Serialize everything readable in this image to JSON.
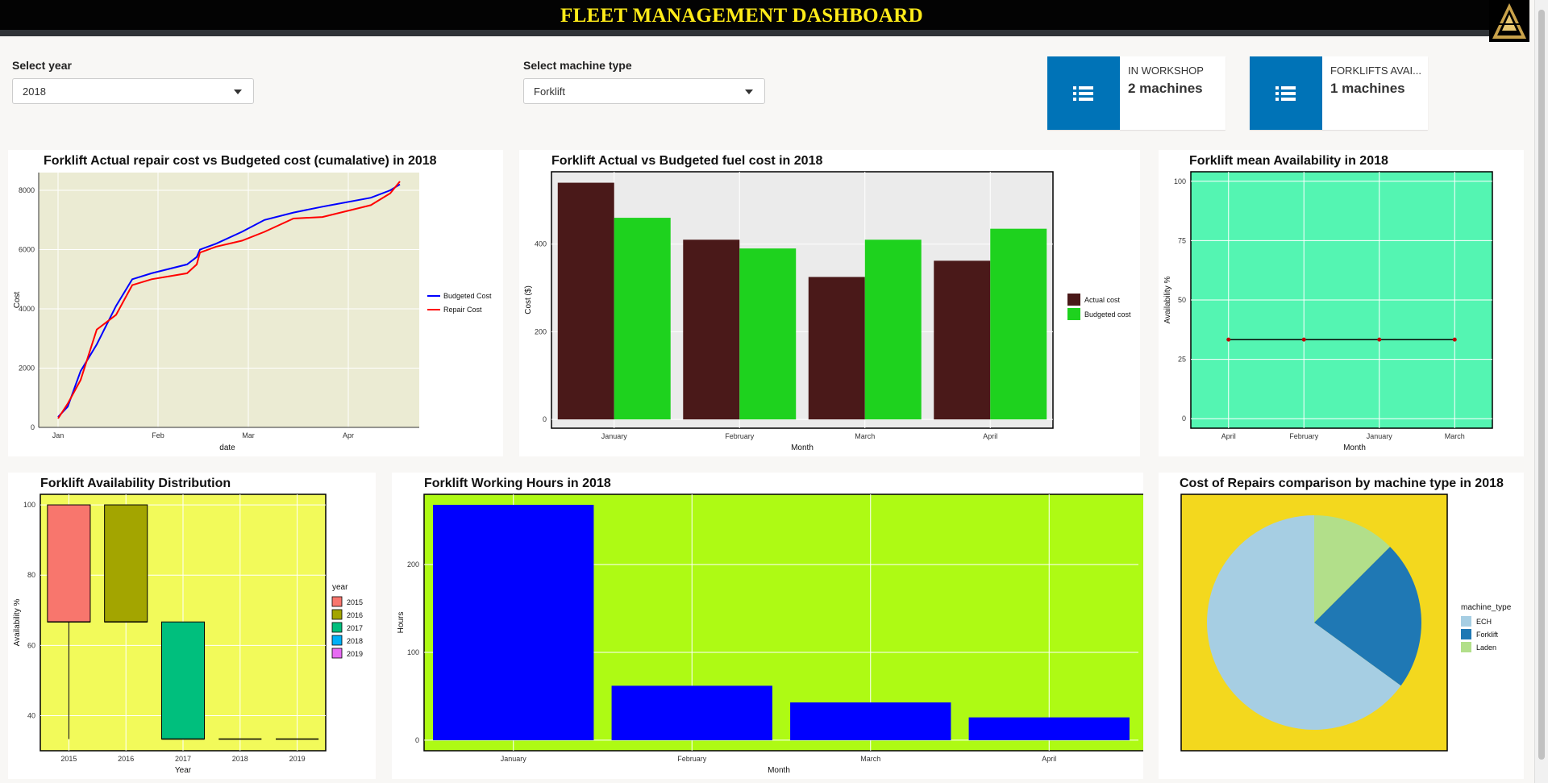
{
  "header": {
    "title": "FLEET MANAGEMENT DASHBOARD",
    "logo_icon": "triangle-logo-icon"
  },
  "filters": {
    "year": {
      "label": "Select year",
      "value": "2018"
    },
    "machine_type": {
      "label": "Select machine type",
      "value": "Forklift"
    }
  },
  "info_boxes": [
    {
      "label": "IN WORKSHOP",
      "value": "2 machines",
      "icon": "list-icon",
      "color": "#0073b7"
    },
    {
      "label": "FORKLIFTS AVAI...",
      "value": "1 machines",
      "icon": "list-icon",
      "color": "#0073b7"
    }
  ],
  "chart_data": [
    {
      "type": "line",
      "title": "Forklift Actual repair cost vs Budgeted cost (cumalative) in  2018",
      "xlabel": "date",
      "ylabel": "Cost",
      "x_ticks": [
        "Jan",
        "Feb",
        "Mar",
        "Apr"
      ],
      "y_ticks": [
        "0",
        "2000",
        "4000",
        "6000",
        "8000"
      ],
      "ylim": [
        0,
        8600
      ],
      "background": "#ebebd3",
      "legend_position": "right",
      "series": [
        {
          "name": "Budgeted Cost",
          "color": "#0000ff",
          "x": [
            "2018-01-01",
            "2018-01-04",
            "2018-01-08",
            "2018-01-13",
            "2018-01-19",
            "2018-01-24",
            "2018-01-30",
            "2018-02-10",
            "2018-02-13",
            "2018-02-14",
            "2018-02-19",
            "2018-02-27",
            "2018-03-06",
            "2018-03-15",
            "2018-03-24",
            "2018-04-08",
            "2018-04-14",
            "2018-04-17"
          ],
          "values": [
            350,
            700,
            1900,
            2800,
            4100,
            5000,
            5200,
            5500,
            5750,
            6000,
            6200,
            6600,
            7000,
            7250,
            7450,
            7750,
            8000,
            8200
          ]
        },
        {
          "name": "Repair Cost",
          "color": "#ff0000",
          "x": [
            "2018-01-01",
            "2018-01-04",
            "2018-01-08",
            "2018-01-13",
            "2018-01-19",
            "2018-01-24",
            "2018-01-30",
            "2018-02-10",
            "2018-02-13",
            "2018-02-14",
            "2018-02-19",
            "2018-02-27",
            "2018-03-06",
            "2018-03-15",
            "2018-03-24",
            "2018-04-08",
            "2018-04-14",
            "2018-04-17"
          ],
          "values": [
            300,
            800,
            1600,
            3300,
            3800,
            4800,
            5000,
            5200,
            5500,
            5900,
            6100,
            6300,
            6600,
            7050,
            7100,
            7500,
            7900,
            8300
          ]
        }
      ]
    },
    {
      "type": "bar",
      "title": "Forklift Actual vs Budgeted fuel cost in 2018",
      "xlabel": "Month",
      "ylabel": "Cost ($)",
      "categories": [
        "January",
        "February",
        "March",
        "April"
      ],
      "y_ticks": [
        "0",
        "200",
        "400"
      ],
      "ylim": [
        -20,
        565
      ],
      "background": "#ebebeb",
      "legend_position": "right",
      "series": [
        {
          "name": "Actual cost",
          "color": "#4a1919",
          "values": [
            540,
            410,
            325,
            362
          ]
        },
        {
          "name": "Budgeted cost",
          "color": "#1ed21e",
          "values": [
            460,
            390,
            410,
            435
          ]
        }
      ]
    },
    {
      "type": "line",
      "title": "Forklift mean Availability in 2018",
      "xlabel": "Month",
      "ylabel": "Availability %",
      "categories": [
        "April",
        "February",
        "January",
        "March"
      ],
      "values": [
        33.33,
        33.33,
        33.33,
        33.33
      ],
      "y_ticks": [
        "0",
        "25",
        "50",
        "75",
        "100"
      ],
      "ylim": [
        -4,
        104
      ],
      "background": "#54f5b2"
    },
    {
      "type": "box",
      "title": "Forklift Availability Distribution",
      "xlabel": "Year",
      "ylabel": "Availability %",
      "categories": [
        "2015",
        "2016",
        "2017",
        "2018",
        "2019"
      ],
      "boxes": [
        {
          "min": 33.33,
          "q1": 66.67,
          "median": 66.67,
          "q3": 100,
          "max": 100,
          "color": "#f8766d"
        },
        {
          "min": 66.67,
          "q1": 66.67,
          "median": 66.67,
          "q3": 100,
          "max": 100,
          "color": "#a3a500"
        },
        {
          "min": 33.33,
          "q1": 33.33,
          "median": 33.33,
          "q3": 66.67,
          "max": 66.67,
          "color": "#00bf7d"
        },
        {
          "min": 33.33,
          "q1": 33.33,
          "median": 33.33,
          "q3": 33.33,
          "max": 33.33,
          "color": "#00b0f6"
        },
        {
          "min": 33.33,
          "q1": 33.33,
          "median": 33.33,
          "q3": 33.33,
          "max": 33.33,
          "color": "#e76bf3"
        }
      ],
      "y_ticks": [
        "40",
        "60",
        "80",
        "100"
      ],
      "ylim": [
        30,
        103
      ],
      "legend_title": "year",
      "background": "#f2fa5a"
    },
    {
      "type": "bar",
      "title": "Forklift Working Hours in 2018",
      "xlabel": "Month",
      "ylabel": "Hours",
      "categories": [
        "January",
        "February",
        "March",
        "April"
      ],
      "values": [
        268,
        62,
        43,
        26
      ],
      "color": "#0000ff",
      "y_ticks": [
        "0",
        "100",
        "200"
      ],
      "ylim": [
        -12,
        280
      ],
      "background": "#aefa14"
    },
    {
      "type": "pie",
      "title": "Cost of Repairs comparison by machine type in  2018",
      "legend_title": "machine_type",
      "labels": [
        "ECH",
        "Forklift",
        "Laden"
      ],
      "values": [
        65.0,
        22.5,
        12.5
      ],
      "colors": [
        "#a6cee3",
        "#1f78b4",
        "#b2df8a"
      ],
      "background": "#f3d81e"
    }
  ]
}
